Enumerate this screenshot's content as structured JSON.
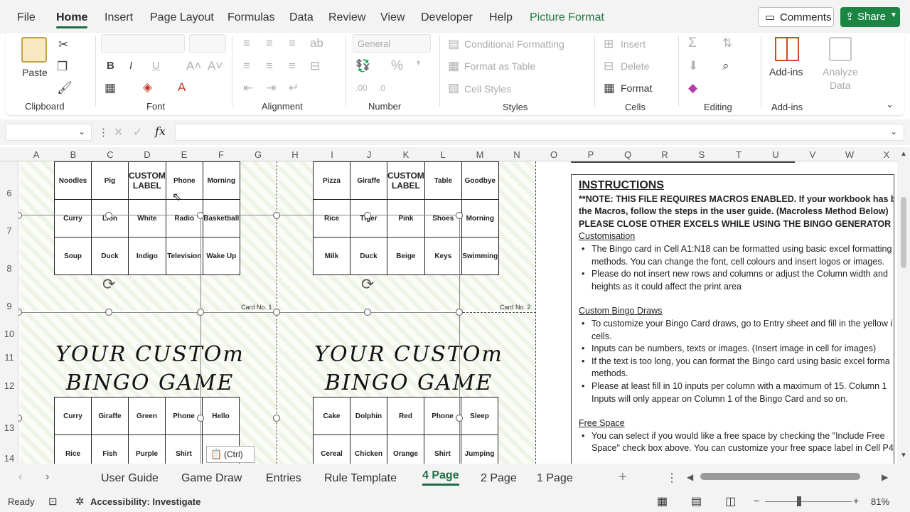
{
  "menu": {
    "tabs": [
      "File",
      "Home",
      "Insert",
      "Page Layout",
      "Formulas",
      "Data",
      "Review",
      "View",
      "Developer",
      "Help",
      "Picture Format"
    ],
    "comments": "Comments",
    "share": "Share"
  },
  "ribbon": {
    "clipboard": {
      "paste": "Paste",
      "group": "Clipboard"
    },
    "font": {
      "group": "Font"
    },
    "alignment": {
      "group": "Alignment"
    },
    "number": {
      "format": "General",
      "group": "Number"
    },
    "styles": {
      "conditional": "Conditional Formatting",
      "format_table": "Format as Table",
      "cell_styles": "Cell Styles",
      "group": "Styles"
    },
    "cells": {
      "insert": "Insert",
      "delete": "Delete",
      "format": "Format",
      "group": "Cells"
    },
    "editing": {
      "group": "Editing"
    },
    "addins": {
      "label": "Add-ins",
      "group": "Add-ins"
    },
    "analyze": {
      "label1": "Analyze",
      "label2": "Data"
    }
  },
  "formula_bar": {
    "fx": "fx",
    "name_box": "",
    "content": ""
  },
  "columns": [
    "A",
    "B",
    "C",
    "D",
    "E",
    "F",
    "G",
    "H",
    "I",
    "J",
    "K",
    "L",
    "M",
    "N",
    "O",
    "P",
    "Q",
    "R",
    "S",
    "T",
    "U",
    "V",
    "W",
    "X"
  ],
  "rows": [
    "6",
    "7",
    "8",
    "9",
    "10",
    "11",
    "12",
    "13",
    "14"
  ],
  "cards": [
    {
      "rows": [
        [
          "Noodles",
          "Pig",
          "CUSTOM LABEL",
          "Phone",
          "Morning"
        ],
        [
          "Curry",
          "Lion",
          "White",
          "Radio",
          "Basketball"
        ],
        [
          "Soup",
          "Duck",
          "Indigo",
          "Television",
          "Wake Up"
        ]
      ],
      "label": "Card No. 1"
    },
    {
      "rows": [
        [
          "Pizza",
          "Giraffe",
          "CUSTOM LABEL",
          "Table",
          "Goodbye"
        ],
        [
          "Rice",
          "Tiger",
          "Pink",
          "Shoes",
          "Morning"
        ],
        [
          "Milk",
          "Duck",
          "Beige",
          "Keys",
          "Swimming"
        ]
      ],
      "label": "Card No. 2"
    },
    {
      "title1": "YOUR CUSTOm",
      "title2": "BINGO GAME",
      "rows": [
        [
          "Curry",
          "Giraffe",
          "Green",
          "Phone",
          "Hello"
        ],
        [
          "Rice",
          "Fish",
          "Purple",
          "Shirt",
          ""
        ]
      ]
    },
    {
      "title1": "YOUR CUSTOm",
      "title2": "BINGO GAME",
      "rows": [
        [
          "Cake",
          "Dolphin",
          "Red",
          "Phone",
          "Sleep"
        ],
        [
          "Cereal",
          "Chicken",
          "Orange",
          "Shirt",
          "Jumping"
        ]
      ]
    }
  ],
  "paste_options": "(Ctrl)",
  "instructions": {
    "heading": "INSTRUCTIONS",
    "note": "**NOTE: THIS FILE REQUIRES MACROS ENABLED. If your workbook has block",
    "note2": "the Macros, follow the steps in the user guide. (Macroless Method Below)",
    "note3": "PLEASE CLOSE OTHER EXCELS WHILE USING THE BINGO GENERATOR",
    "custom_h": "Customisation",
    "c1": "The Bingo card in Cell A1:N18 can be formatted using basic excel formatting",
    "c1b": "methods. You can change the font, cell colours and insert logos or images.",
    "c2": "Please do not insert new rows and columns or adjust the Column width and",
    "c2b": "heights as it could affect the print area",
    "draws_h": "Custom Bingo Draws",
    "d1": "To customize your Bingo Card draws, go to Entry sheet and fill in the yellow i",
    "d1b": "cells.",
    "d2": "Inputs can be numbers, texts or images. (Insert image in cell for images)",
    "d3": "If the text is too long, you can format the Bingo card using basic excel forma",
    "d3b": "methods.",
    "d4": "Please at least fill in 10 inputs per column with a maximum of 15. Column 1",
    "d4b": "Inputs will only appear on Column 1 of the Bingo Card and so on.",
    "free_h": "Free Space",
    "f1": "You can select if you would like a free space by checking the \"Include Free",
    "f1b": "Space\" check box above. You can customize your free space label in Cell P4"
  },
  "sheet_tabs": [
    "User Guide",
    "Game Draw",
    "Entries",
    "Rule Template",
    "4 Page",
    "2 Page",
    "1 Page"
  ],
  "active_tab": "4 Page",
  "status": {
    "ready": "Ready",
    "accessibility": "Accessibility: Investigate",
    "zoom": "81%"
  }
}
